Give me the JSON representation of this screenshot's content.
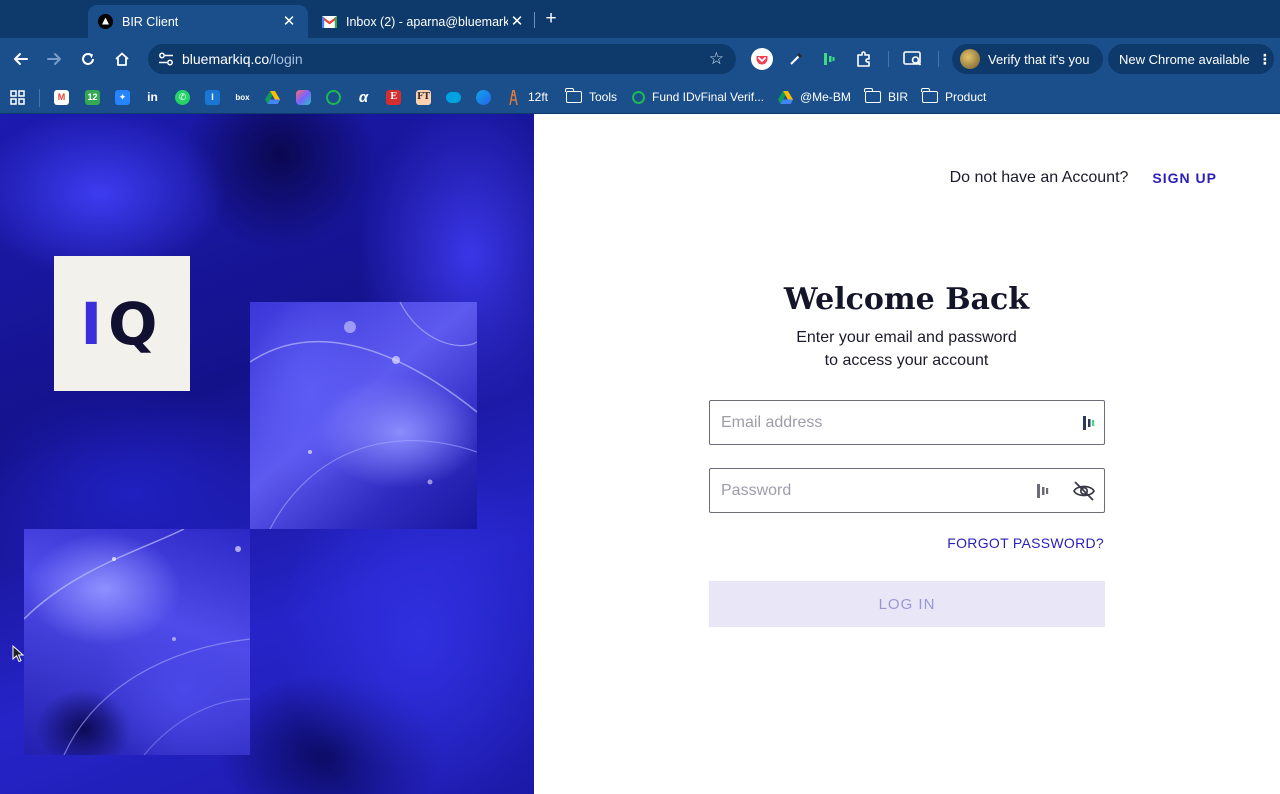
{
  "browser": {
    "tabs": [
      {
        "title": "BIR Client",
        "active": true,
        "favicon": "triangle-logo-icon"
      },
      {
        "title": "Inbox (2) - aparna@bluemark",
        "active": false,
        "favicon": "gmail-icon"
      }
    ],
    "url": {
      "host": "bluemarkiq.co",
      "path": "/login"
    },
    "verify_label": "Verify that it's you",
    "update_label": "New Chrome available",
    "bookmarks": [
      {
        "label": "12ft"
      },
      {
        "label": "Tools"
      },
      {
        "label": "Fund IDvFinal Verif..."
      },
      {
        "label": "@Me-BM"
      },
      {
        "label": "BIR"
      },
      {
        "label": "Product"
      }
    ]
  },
  "brand": {
    "logo_i": "I",
    "logo_q": "Q",
    "accent": "#2a1fb8"
  },
  "header": {
    "question": "Do not have an Account?",
    "signup_label": "SIGN UP"
  },
  "login": {
    "title": "Welcome Back",
    "subtitle_line1": "Enter your email and password",
    "subtitle_line2": "to access your account",
    "email_placeholder": "Email address",
    "password_placeholder": "Password",
    "forgot_label": "FORGOT PASSWORD?",
    "submit_label": "LOG IN"
  }
}
